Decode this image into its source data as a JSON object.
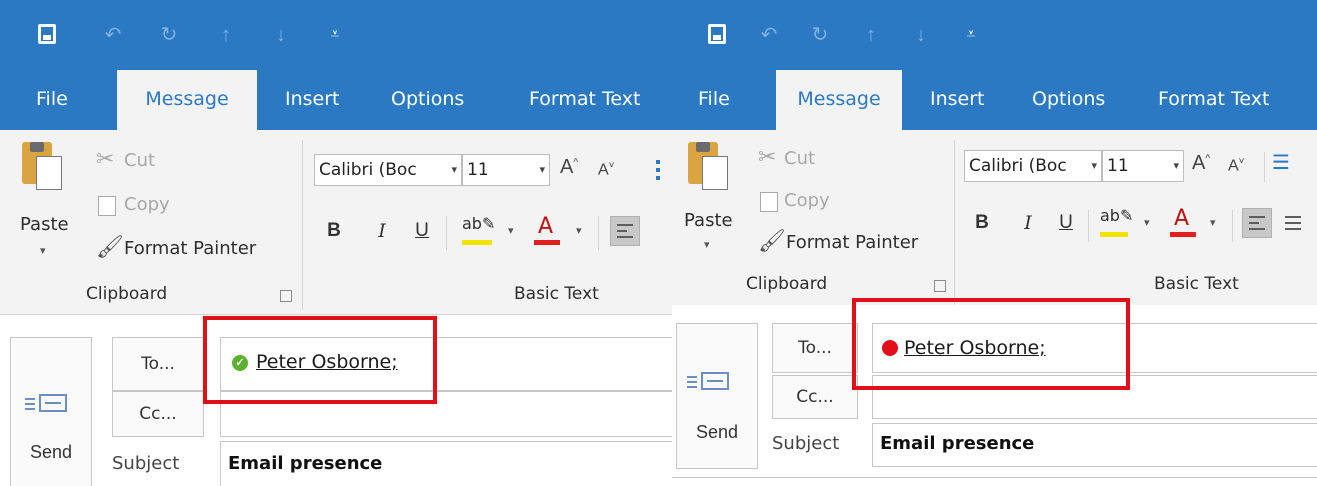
{
  "panels": {
    "left": {
      "tabs": {
        "file": "File",
        "message": "Message",
        "insert": "Insert",
        "options": "Options",
        "format_text": "Format Text"
      },
      "clipboard": {
        "paste": "Paste",
        "cut": "Cut",
        "copy": "Copy",
        "format_painter": "Format Painter",
        "group_label": "Clipboard"
      },
      "basic_text": {
        "font_name": "Calibri (Boc",
        "font_size": "11",
        "bold": "B",
        "italic": "I",
        "underline": "U",
        "group_label": "Basic Text"
      },
      "compose": {
        "send": "Send",
        "to_button": "To...",
        "cc_button": "Cc...",
        "subject_label": "Subject",
        "subject_value": "Email presence",
        "recipient": "Peter Osborne;"
      },
      "presence": {
        "status": "available",
        "color": "#5cb130"
      }
    },
    "right": {
      "tabs": {
        "file": "File",
        "message": "Message",
        "insert": "Insert",
        "options": "Options",
        "format_text": "Format Text"
      },
      "clipboard": {
        "paste": "Paste",
        "cut": "Cut",
        "copy": "Copy",
        "format_painter": "Format Painter",
        "group_label": "Clipboard"
      },
      "basic_text": {
        "font_name": "Calibri (Boc",
        "font_size": "11",
        "bold": "B",
        "italic": "I",
        "underline": "U",
        "group_label": "Basic Text"
      },
      "compose": {
        "send": "Send",
        "to_button": "To...",
        "cc_button": "Cc...",
        "subject_label": "Subject",
        "subject_value": "Email presence",
        "recipient": "Peter Osborne;"
      },
      "presence": {
        "status": "busy",
        "color": "#e0101b"
      }
    }
  },
  "colors": {
    "accent": "#2b79c2",
    "highlight_box": "#e0101b"
  },
  "icons": [
    "save-icon",
    "undo-icon",
    "redo-icon",
    "up-arrow-icon",
    "down-arrow-icon",
    "customize-qat-icon",
    "paste-icon",
    "cut-icon",
    "copy-icon",
    "format-painter-icon",
    "send-icon"
  ]
}
